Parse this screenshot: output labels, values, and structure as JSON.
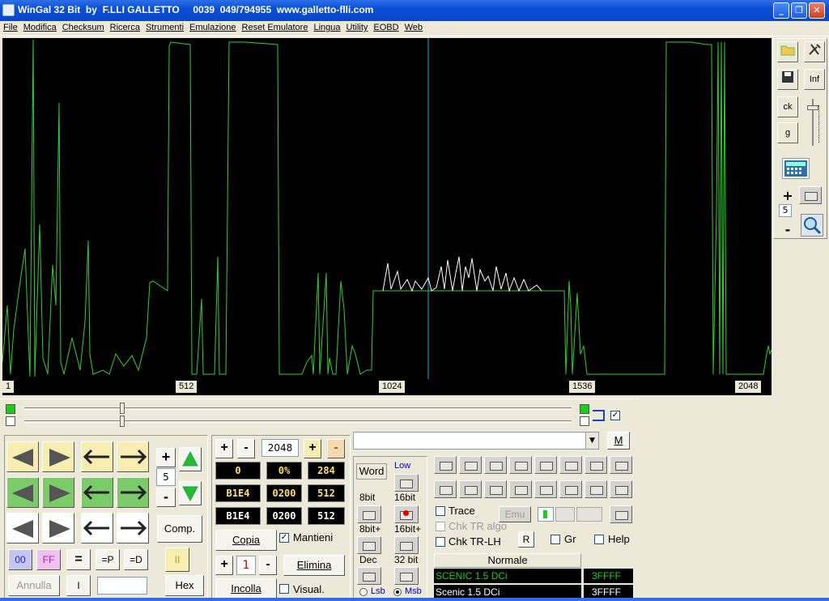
{
  "window": {
    "title": "WinGal 32 Bit  by  F.LLI GALLETTO     0039  049/794955  www.galletto-flli.com",
    "minimize": "_",
    "maximize": "❐",
    "close": "✕"
  },
  "menu": [
    "File",
    "Modifica",
    "Checksum",
    "Ricerca",
    "Strumenti",
    "Emulazione",
    "Reset Emulatore",
    "Lingua",
    "Utility",
    "EOBD",
    "Web"
  ],
  "axis": {
    "ticks": [
      "1",
      "512",
      "1024",
      "1536",
      "2048"
    ]
  },
  "colors": {
    "scope_bg": "#000000",
    "trace": "#2FD12F",
    "trace2": "#FFFFFF",
    "cursor": "#2FA8C8"
  },
  "right_panel": {
    "ck": "ck",
    "g": "g",
    "inf": "Inf",
    "plus": "+",
    "minus": "-",
    "step": "5",
    "icons": [
      "open-folder-icon",
      "tools-icon",
      "save-icon",
      "calculator-icon",
      "folder-icon",
      "magnifier-icon"
    ]
  },
  "controls": {
    "step_value": "5",
    "plus": "+",
    "minus": "-",
    "comp": "Comp.",
    "btn_00": "00",
    "btn_ff": "FF",
    "btn_eq": "=",
    "btn_eqp": "=P",
    "btn_eqd": "=D",
    "btn_pause": "II",
    "annulla": "Annulla",
    "btn_i": "I",
    "hex": "Hex"
  },
  "middle": {
    "plus": "+",
    "minus": "-",
    "size": "2048",
    "row1": [
      "0",
      "0%",
      "284"
    ],
    "row2": [
      "B1E4",
      "0200",
      "512"
    ],
    "row3": [
      "B1E4",
      "0200",
      "512"
    ],
    "copia": "Copia",
    "mantieni": "Mantieni",
    "count": "1",
    "elimina": "Elimina",
    "incolla": "Incolla",
    "visual": "Visual."
  },
  "format": {
    "word": "Word",
    "low": "Low",
    "bit8": "8bit",
    "bit16": "16bit",
    "bit8p": "8bit+",
    "bit16p": "16bit+",
    "dec": "Dec",
    "bit32": "32 bit",
    "lsb": "Lsb",
    "msb": "Msb"
  },
  "right_controls": {
    "m": "M",
    "trace": "Trace",
    "emu": "Emu",
    "chk_tr_algo": "Chk TR algo",
    "chk_tr_lh": "Chk TR-LH",
    "r": "R",
    "gr": "Gr",
    "help": "Help",
    "normale": "Normale",
    "rows": [
      {
        "name": "SCENIC 1.5 DCi",
        "size": "3FFFF"
      },
      {
        "name": "Scenic 1.5 DCi",
        "size": "3FFFF"
      }
    ]
  }
}
